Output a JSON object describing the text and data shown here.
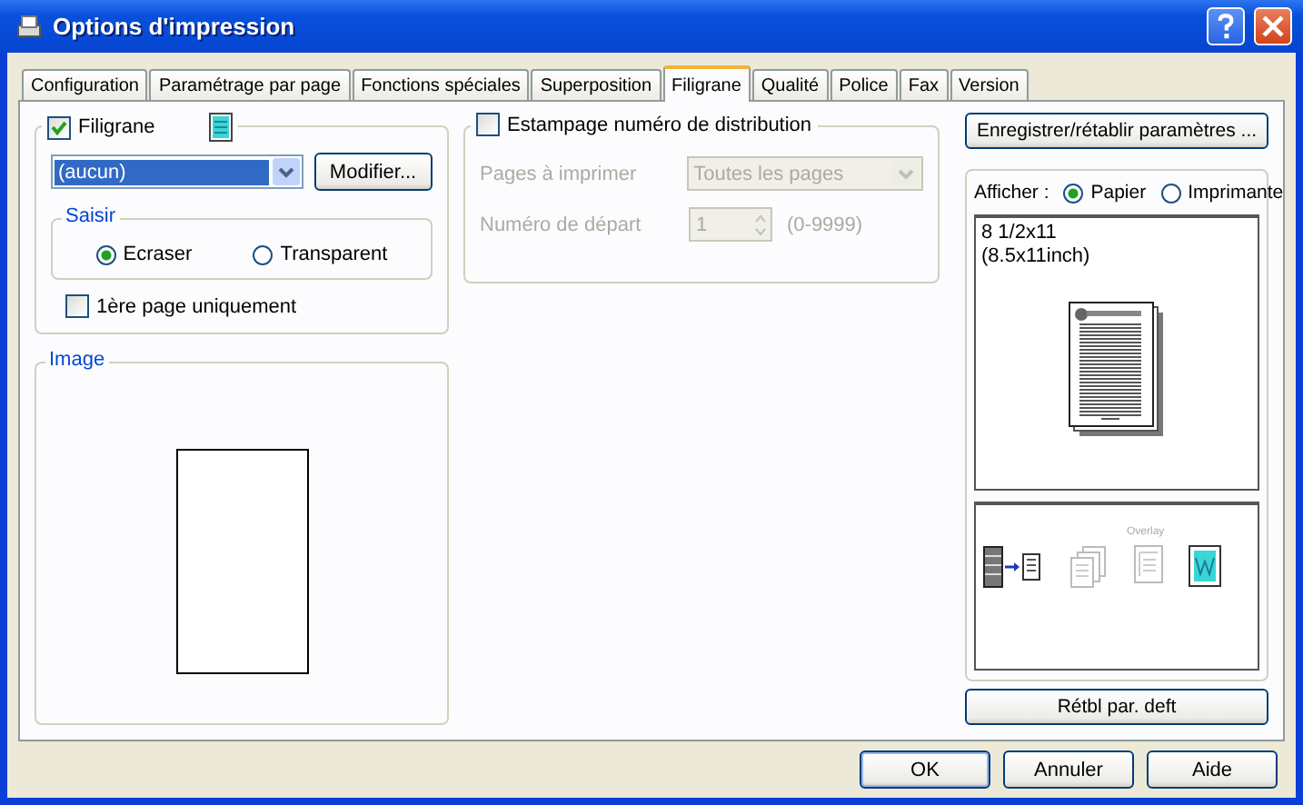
{
  "window": {
    "title": "Options d'impression"
  },
  "tabs": [
    {
      "label": "Configuration",
      "selected": false
    },
    {
      "label": "Paramétrage par page",
      "selected": false
    },
    {
      "label": "Fonctions spéciales",
      "selected": false
    },
    {
      "label": "Superposition",
      "selected": false
    },
    {
      "label": "Filigrane",
      "selected": true
    },
    {
      "label": "Qualité",
      "selected": false
    },
    {
      "label": "Police",
      "selected": false
    },
    {
      "label": "Fax",
      "selected": false
    },
    {
      "label": "Version",
      "selected": false
    }
  ],
  "watermark": {
    "label": "Filigrane",
    "checked": true,
    "value": "(aucun)",
    "modify_button": "Modifier...",
    "mode_title": "Saisir",
    "modes": [
      {
        "label": "Ecraser",
        "selected": true
      },
      {
        "label": "Transparent",
        "selected": false
      }
    ],
    "first_page_only": {
      "label": "1ère page uniquement",
      "checked": false
    }
  },
  "image_group": {
    "title": "Image"
  },
  "stamp": {
    "label": "Estampage numéro de distribution",
    "checked": false,
    "disabled": true,
    "pages_label": "Pages à imprimer",
    "pages_value": "Toutes les pages",
    "start_label": "Numéro de départ",
    "start_value": "1",
    "range": "(0-9999)"
  },
  "save_button": "Enregistrer/rétablir paramètres ...",
  "display": {
    "label": "Afficher :",
    "options": [
      {
        "label": "Papier",
        "selected": true
      },
      {
        "label": "Imprimante",
        "selected": false
      }
    ]
  },
  "paper_size": [
    "8 1/2x11",
    "(8.5x11inch)"
  ],
  "overlay_label": "Overlay",
  "reset_button": "Rétbl par. deft",
  "buttons": [
    "OK",
    "Annuler",
    "Aide"
  ]
}
